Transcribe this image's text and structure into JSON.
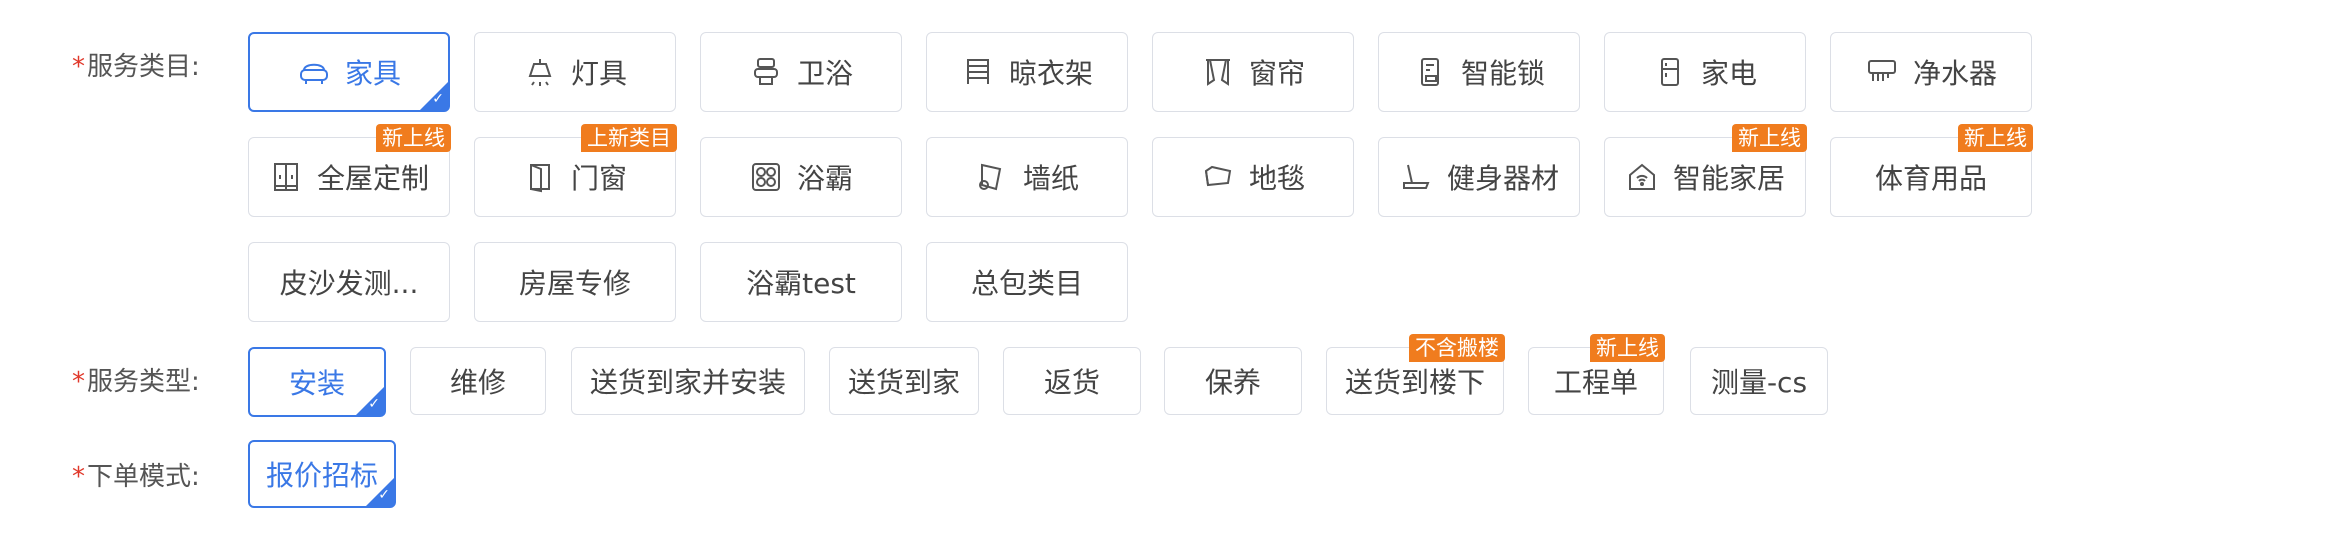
{
  "colors": {
    "accent": "#3a78e6",
    "badge": "#f07c1e",
    "required": "#e0392b"
  },
  "service_category": {
    "label": "服务类目:",
    "items": [
      {
        "label": "家具",
        "icon": "sofa-icon",
        "selected": true
      },
      {
        "label": "灯具",
        "icon": "lamp-icon"
      },
      {
        "label": "卫浴",
        "icon": "toilet-icon"
      },
      {
        "label": "晾衣架",
        "icon": "clothes-rack-icon"
      },
      {
        "label": "窗帘",
        "icon": "curtain-icon"
      },
      {
        "label": "智能锁",
        "icon": "smart-lock-icon"
      },
      {
        "label": "家电",
        "icon": "appliance-icon"
      },
      {
        "label": "净水器",
        "icon": "water-purifier-icon"
      },
      {
        "label": "全屋定制",
        "icon": "cabinet-icon",
        "badge": "新上线"
      },
      {
        "label": "门窗",
        "icon": "door-icon",
        "badge": "上新类目"
      },
      {
        "label": "浴霸",
        "icon": "bath-heater-icon"
      },
      {
        "label": "墙纸",
        "icon": "wallpaper-icon"
      },
      {
        "label": "地毯",
        "icon": "carpet-icon"
      },
      {
        "label": "健身器材",
        "icon": "treadmill-icon"
      },
      {
        "label": "智能家居",
        "icon": "smart-home-icon",
        "badge": "新上线"
      },
      {
        "label": "体育用品",
        "badge": "新上线"
      },
      {
        "label": "皮沙发测..."
      },
      {
        "label": "房屋专修"
      },
      {
        "label": "浴霸test"
      },
      {
        "label": "总包类目"
      }
    ]
  },
  "service_type": {
    "label": "服务类型:",
    "items": [
      {
        "label": "安装",
        "selected": true
      },
      {
        "label": "维修"
      },
      {
        "label": "送货到家并安装"
      },
      {
        "label": "送货到家"
      },
      {
        "label": "返货"
      },
      {
        "label": "保养"
      },
      {
        "label": "送货到楼下",
        "badge": "不含搬楼"
      },
      {
        "label": "工程单",
        "badge": "新上线"
      },
      {
        "label": "测量-cs"
      }
    ]
  },
  "order_mode": {
    "label": "下单模式:",
    "items": [
      {
        "label": "报价招标",
        "selected": true
      }
    ]
  }
}
